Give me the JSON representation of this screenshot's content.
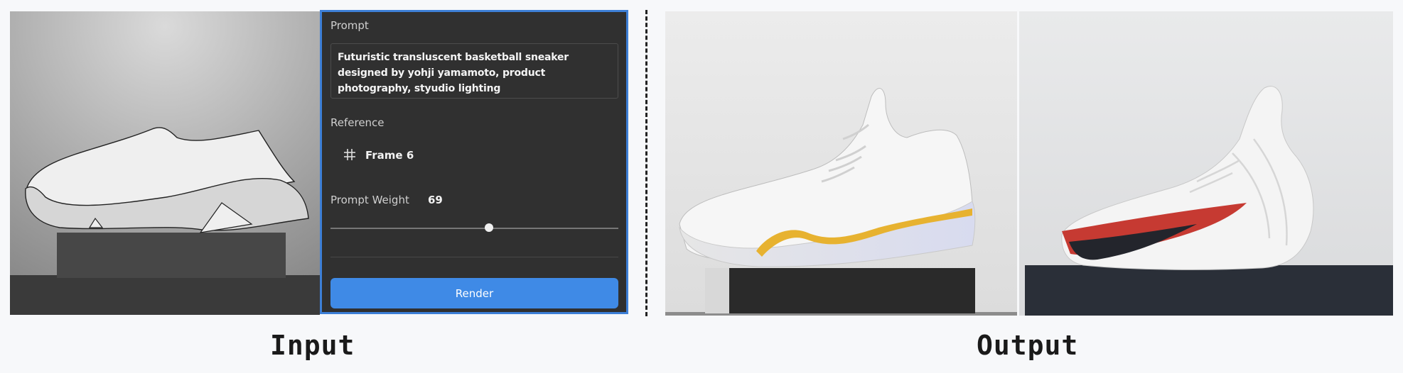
{
  "panel": {
    "prompt_label": "Prompt",
    "prompt_text": "Futuristic transluscent basketball sneaker designed by yohji yamamoto, product photography, styudio lighting",
    "reference_label": "Reference",
    "reference_frame": "Frame 6",
    "weight_label": "Prompt Weight",
    "weight_value": "69",
    "weight_level_percent": 55,
    "render_label": "Render",
    "accent_color": "#3f8ae6",
    "icons": {
      "reference": "frame-hash-icon"
    }
  },
  "captions": {
    "input": "Input",
    "output": "Output"
  }
}
